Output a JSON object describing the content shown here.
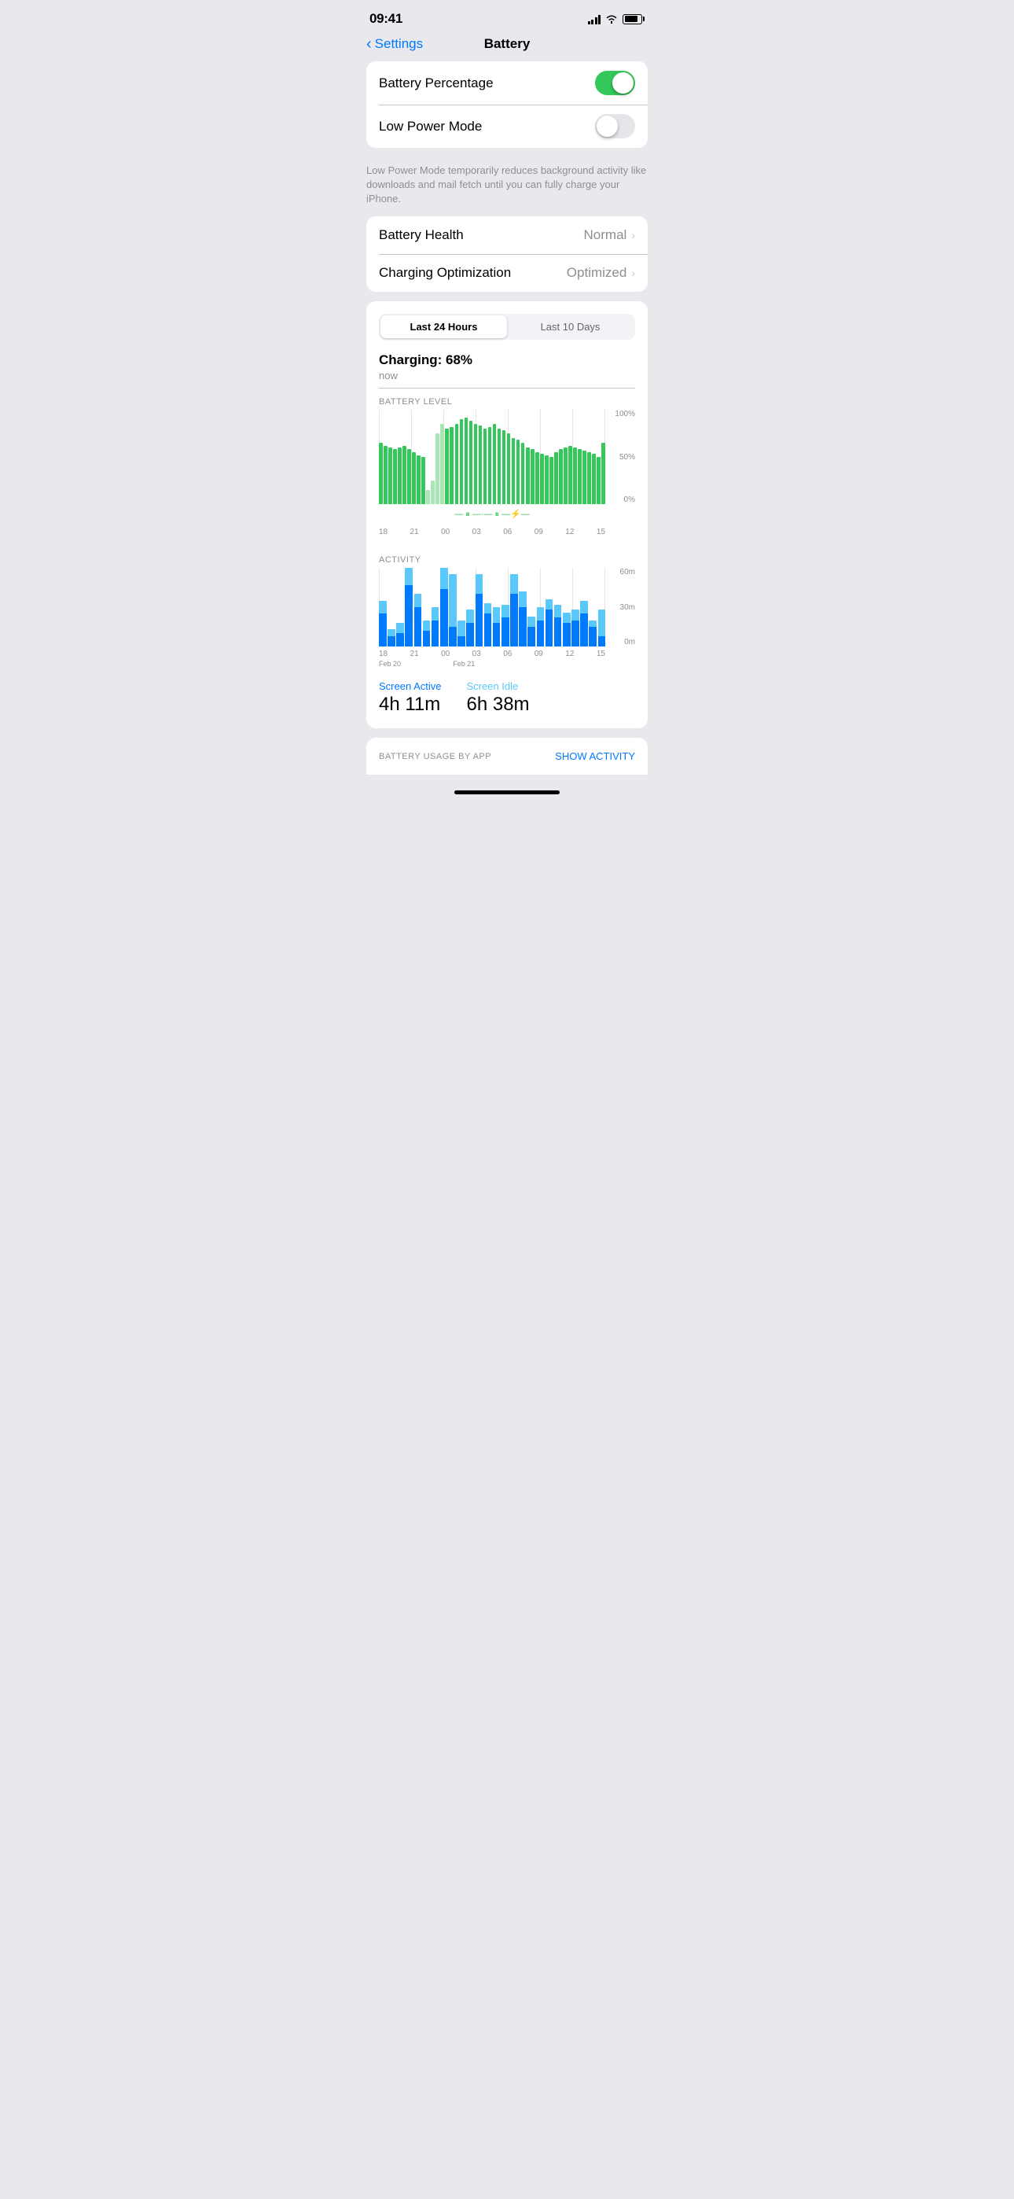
{
  "statusBar": {
    "time": "09:41",
    "signalBars": 4,
    "wifi": true,
    "battery": 80
  },
  "header": {
    "backLabel": "Settings",
    "title": "Battery"
  },
  "settings": {
    "section1": {
      "rows": [
        {
          "label": "Battery Percentage",
          "type": "toggle",
          "value": true
        },
        {
          "label": "Low Power Mode",
          "type": "toggle",
          "value": false
        }
      ],
      "description": "Low Power Mode temporarily reduces background activity like downloads and mail fetch until you can fully charge your iPhone."
    },
    "section2": {
      "rows": [
        {
          "label": "Battery Health",
          "value": "Normal",
          "type": "nav"
        },
        {
          "label": "Charging Optimization",
          "value": "Optimized",
          "type": "nav"
        }
      ]
    }
  },
  "chartSection": {
    "tabs": [
      "Last 24 Hours",
      "Last 10 Days"
    ],
    "activeTab": 0,
    "chargingTitle": "Charging: 68%",
    "chargingSubtitle": "now",
    "batteryChart": {
      "label": "BATTERY LEVEL",
      "yLabels": [
        "100%",
        "50%",
        "0%"
      ],
      "xLabels": [
        "18",
        "21",
        "00",
        "03",
        "06",
        "09",
        "12",
        "15"
      ],
      "bars": [
        65,
        62,
        60,
        58,
        60,
        62,
        58,
        55,
        52,
        50,
        15,
        25,
        75,
        85,
        80,
        82,
        85,
        90,
        92,
        88,
        85,
        83,
        80,
        82,
        85,
        80,
        78,
        75,
        70,
        68,
        65,
        60,
        58,
        55,
        53,
        52,
        50,
        55,
        58,
        60,
        62,
        60,
        58,
        57,
        55,
        53,
        50,
        65
      ]
    },
    "activityChart": {
      "label": "ACTIVITY",
      "yLabels": [
        "60m",
        "30m",
        "0m"
      ],
      "xLabels": [
        "18",
        "21",
        "00",
        "03",
        "06",
        "09",
        "12",
        "15"
      ],
      "dateLabels": [
        "Feb 20",
        "",
        "Feb 21",
        ""
      ],
      "bars": [
        {
          "dark": 25,
          "light": 10
        },
        {
          "dark": 8,
          "light": 5
        },
        {
          "dark": 10,
          "light": 8
        },
        {
          "dark": 55,
          "light": 15
        },
        {
          "dark": 30,
          "light": 10
        },
        {
          "dark": 12,
          "light": 8
        },
        {
          "dark": 20,
          "light": 10
        },
        {
          "dark": 55,
          "light": 20
        },
        {
          "dark": 15,
          "light": 40
        },
        {
          "dark": 8,
          "light": 12
        },
        {
          "dark": 18,
          "light": 10
        },
        {
          "dark": 40,
          "light": 15
        },
        {
          "dark": 25,
          "light": 8
        },
        {
          "dark": 18,
          "light": 12
        },
        {
          "dark": 22,
          "light": 10
        },
        {
          "dark": 40,
          "light": 15
        },
        {
          "dark": 30,
          "light": 12
        },
        {
          "dark": 15,
          "light": 8
        },
        {
          "dark": 20,
          "light": 10
        },
        {
          "dark": 28,
          "light": 8
        },
        {
          "dark": 22,
          "light": 10
        },
        {
          "dark": 18,
          "light": 8
        },
        {
          "dark": 20,
          "light": 8
        },
        {
          "dark": 25,
          "light": 10
        },
        {
          "dark": 15,
          "light": 5
        },
        {
          "dark": 8,
          "light": 20
        }
      ]
    },
    "screenActive": {
      "label": "Screen Active",
      "value": "4h 11m"
    },
    "screenIdle": {
      "label": "Screen Idle",
      "value": "6h 38m"
    }
  },
  "bottomBar": {
    "label": "BATTERY USAGE BY APP",
    "action": "SHOW ACTIVITY"
  }
}
